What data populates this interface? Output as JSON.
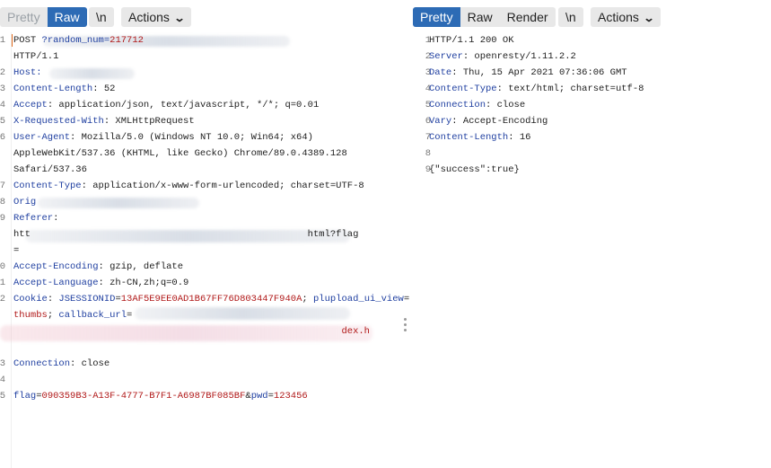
{
  "request": {
    "tabs": [
      {
        "label": "Pretty",
        "state": "inactive"
      },
      {
        "label": "Raw",
        "state": "active"
      }
    ],
    "newline_toggle": "\\n",
    "actions_label": "Actions",
    "lines": [
      {
        "num": "1",
        "parts": [
          {
            "t": "POST "
          },
          {
            "t": "?random_num=",
            "c": "hk"
          },
          {
            "t": "217712",
            "c": "pv"
          }
        ]
      },
      {
        "num": "",
        "parts": [
          {
            "t": "HTTP/1.1"
          }
        ]
      },
      {
        "num": "2",
        "parts": [
          {
            "t": "Host: ",
            "c": "hk"
          }
        ]
      },
      {
        "num": "3",
        "parts": [
          {
            "t": "Content-Length",
            "c": "hk"
          },
          {
            "t": ": 52"
          }
        ]
      },
      {
        "num": "4",
        "parts": [
          {
            "t": "Accept",
            "c": "hk"
          },
          {
            "t": ": application/json, text/javascript, */*; q=0.01"
          }
        ]
      },
      {
        "num": "5",
        "parts": [
          {
            "t": "X-Requested-With",
            "c": "hk"
          },
          {
            "t": ": XMLHttpRequest"
          }
        ]
      },
      {
        "num": "6",
        "parts": [
          {
            "t": "User-Agent",
            "c": "hk"
          },
          {
            "t": ": Mozilla/5.0 (Windows NT 10.0; Win64; x64)"
          }
        ]
      },
      {
        "num": "",
        "parts": [
          {
            "t": "AppleWebKit/537.36 (KHTML, like Gecko) Chrome/89.0.4389.128"
          }
        ]
      },
      {
        "num": "",
        "parts": [
          {
            "t": "Safari/537.36"
          }
        ]
      },
      {
        "num": "7",
        "parts": [
          {
            "t": "Content-Type",
            "c": "hk"
          },
          {
            "t": ": application/x-www-form-urlencoded; charset=UTF-8"
          }
        ]
      },
      {
        "num": "8",
        "parts": [
          {
            "t": "Orig",
            "c": "hk"
          }
        ]
      },
      {
        "num": "9",
        "parts": [
          {
            "t": "Referer",
            "c": "hk"
          },
          {
            "t": ":"
          }
        ]
      },
      {
        "num": "",
        "parts": [
          {
            "t": "htt"
          },
          {
            "t": "                                                 "
          },
          {
            "t": "html?flag"
          }
        ]
      },
      {
        "num": "",
        "parts": [
          {
            "t": "="
          }
        ]
      },
      {
        "num": "0",
        "parts": [
          {
            "t": "Accept-Encoding",
            "c": "hk"
          },
          {
            "t": ": gzip, deflate"
          }
        ]
      },
      {
        "num": "1",
        "parts": [
          {
            "t": "Accept-Language",
            "c": "hk"
          },
          {
            "t": ": zh-CN,zh;q=0.9"
          }
        ]
      },
      {
        "num": "2",
        "parts": [
          {
            "t": "Cookie",
            "c": "hk"
          },
          {
            "t": ": "
          },
          {
            "t": "JSESSIONID",
            "c": "hk"
          },
          {
            "t": "="
          },
          {
            "t": "13AF5E9EE0AD1B67FF76D803447F940A",
            "c": "pv"
          },
          {
            "t": "; "
          },
          {
            "t": "plupload_ui_view",
            "c": "hk"
          },
          {
            "t": "="
          }
        ]
      },
      {
        "num": "",
        "parts": [
          {
            "t": "thumbs",
            "c": "pv"
          },
          {
            "t": "; "
          },
          {
            "t": "callback_url",
            "c": "hk"
          },
          {
            "t": "="
          }
        ]
      },
      {
        "num": "",
        "parts": [
          {
            "t": "                                                          "
          },
          {
            "t": "dex.h",
            "c": "pv"
          }
        ]
      },
      {
        "num": "",
        "parts": []
      },
      {
        "num": "3",
        "parts": [
          {
            "t": "Connection",
            "c": "hk"
          },
          {
            "t": ": close"
          }
        ]
      },
      {
        "num": "4",
        "parts": []
      },
      {
        "num": "5",
        "parts": [
          {
            "t": "flag",
            "c": "hk"
          },
          {
            "t": "="
          },
          {
            "t": "090359B3-A13F-4777-B7F1-A6987BF085BF",
            "c": "pv"
          },
          {
            "t": "&"
          },
          {
            "t": "pwd",
            "c": "hk"
          },
          {
            "t": "="
          },
          {
            "t": "123456",
            "c": "pv"
          }
        ]
      }
    ]
  },
  "response": {
    "tabs": [
      {
        "label": "Pretty",
        "state": "active"
      },
      {
        "label": "Raw",
        "state": "inactive"
      },
      {
        "label": "Render",
        "state": "inactive"
      }
    ],
    "newline_toggle": "\\n",
    "actions_label": "Actions",
    "lines": [
      {
        "num": "1",
        "parts": [
          {
            "t": "HTTP/1.1 200 OK"
          }
        ]
      },
      {
        "num": "2",
        "parts": [
          {
            "t": "Server",
            "c": "hk"
          },
          {
            "t": ": openresty/1.11.2.2"
          }
        ]
      },
      {
        "num": "3",
        "parts": [
          {
            "t": "Date",
            "c": "hk"
          },
          {
            "t": ": Thu, 15 Apr 2021 07:36:06 GMT"
          }
        ]
      },
      {
        "num": "4",
        "parts": [
          {
            "t": "Content-Type",
            "c": "hk"
          },
          {
            "t": ": text/html; charset=utf-8"
          }
        ]
      },
      {
        "num": "5",
        "parts": [
          {
            "t": "Connection",
            "c": "hk"
          },
          {
            "t": ": close"
          }
        ]
      },
      {
        "num": "6",
        "parts": [
          {
            "t": "Vary",
            "c": "hk"
          },
          {
            "t": ": Accept-Encoding"
          }
        ]
      },
      {
        "num": "7",
        "parts": [
          {
            "t": "Content-Length",
            "c": "hk"
          },
          {
            "t": ": 16"
          }
        ]
      },
      {
        "num": "8",
        "parts": []
      },
      {
        "num": "9",
        "parts": [
          {
            "t": "{\"success\":true}"
          }
        ]
      }
    ]
  },
  "colors": {
    "active_tab": "#2d6bb5",
    "header_key": "#1f3fa0",
    "param_value": "#b01818"
  },
  "icons": {
    "actions_dropdown": "chevron-down-icon",
    "splitter": "drag-handle-icon"
  }
}
